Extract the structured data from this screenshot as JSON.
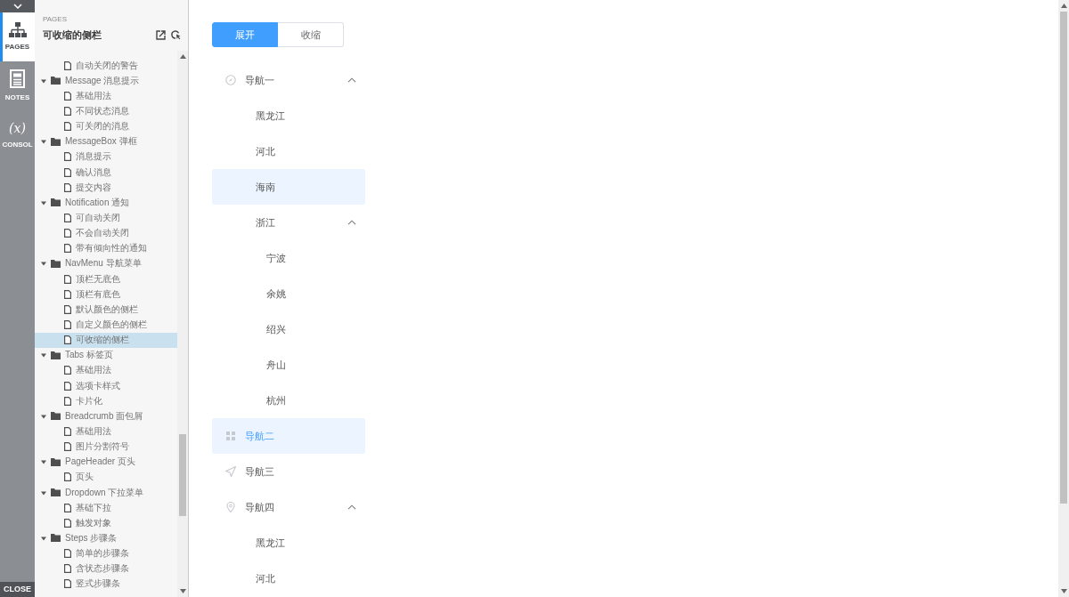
{
  "rail": {
    "tabs": [
      {
        "label": "PAGES",
        "selected": true
      },
      {
        "label": "NOTES",
        "selected": false
      },
      {
        "label": "CONSOL",
        "glyph": "(x)",
        "selected": false
      }
    ],
    "close": "CLOSE"
  },
  "sidebar": {
    "section": "PAGES",
    "title": "可收缩的侧栏",
    "tree": [
      {
        "children": [
          {
            "kind": "page",
            "label": "自动关闭的警告",
            "selected": false
          }
        ]
      },
      {
        "kind": "folder",
        "label": "Message 消息提示",
        "expanded": true,
        "children": [
          {
            "kind": "page",
            "label": "基础用法",
            "selected": false
          },
          {
            "kind": "page",
            "label": "不同状态消息",
            "selected": false
          },
          {
            "kind": "page",
            "label": "可关闭的消息",
            "selected": false
          }
        ]
      },
      {
        "kind": "folder",
        "label": "MessageBox 弹框",
        "expanded": true,
        "children": [
          {
            "kind": "page",
            "label": "消息提示",
            "selected": false
          },
          {
            "kind": "page",
            "label": "确认消息",
            "selected": false
          },
          {
            "kind": "page",
            "label": "提交内容",
            "selected": false
          }
        ]
      },
      {
        "kind": "folder",
        "label": "Notification 通知",
        "expanded": true,
        "children": [
          {
            "kind": "page",
            "label": "可自动关闭",
            "selected": false
          },
          {
            "kind": "page",
            "label": "不会自动关闭",
            "selected": false
          },
          {
            "kind": "page",
            "label": "带有倾向性的通知",
            "selected": false
          }
        ]
      },
      {
        "kind": "folder",
        "label": "NavMenu 导航菜单",
        "expanded": true,
        "children": [
          {
            "kind": "page",
            "label": "顶栏无底色",
            "selected": false
          },
          {
            "kind": "page",
            "label": "顶栏有底色",
            "selected": false
          },
          {
            "kind": "page",
            "label": "默认颜色的侧栏",
            "selected": false
          },
          {
            "kind": "page",
            "label": "自定义颜色的侧栏",
            "selected": false
          },
          {
            "kind": "page",
            "label": "可收缩的侧栏",
            "selected": true
          }
        ]
      },
      {
        "kind": "folder",
        "label": "Tabs 标签页",
        "expanded": true,
        "children": [
          {
            "kind": "page",
            "label": "基础用法",
            "selected": false
          },
          {
            "kind": "page",
            "label": "选项卡样式",
            "selected": false
          },
          {
            "kind": "page",
            "label": "卡片化",
            "selected": false
          }
        ]
      },
      {
        "kind": "folder",
        "label": "Breadcrumb 面包屑",
        "expanded": true,
        "children": [
          {
            "kind": "page",
            "label": "基础用法",
            "selected": false
          },
          {
            "kind": "page",
            "label": "图片分割符号",
            "selected": false
          }
        ]
      },
      {
        "kind": "folder",
        "label": "PageHeader 页头",
        "expanded": true,
        "children": [
          {
            "kind": "page",
            "label": "页头",
            "selected": false
          }
        ]
      },
      {
        "kind": "folder",
        "label": "Dropdown 下拉菜单",
        "expanded": true,
        "children": [
          {
            "kind": "page",
            "label": "基础下拉",
            "selected": false
          },
          {
            "kind": "page",
            "label": "触发对象",
            "selected": false
          }
        ]
      },
      {
        "kind": "folder",
        "label": "Steps 步骤条",
        "expanded": true,
        "children": [
          {
            "kind": "page",
            "label": "简单的步骤条",
            "selected": false
          },
          {
            "kind": "page",
            "label": "含状态步骤条",
            "selected": false
          },
          {
            "kind": "page",
            "label": "竖式步骤条",
            "selected": false
          }
        ]
      }
    ]
  },
  "preview": {
    "toggle": [
      {
        "label": "展开",
        "selected": true
      },
      {
        "label": "收缩",
        "selected": false
      }
    ],
    "menu": [
      {
        "label": "导航一",
        "selected": false,
        "hovered": false,
        "expanded": true,
        "children": [
          {
            "label": "黑龙江",
            "selected": false,
            "hovered": false
          },
          {
            "label": "河北",
            "selected": false,
            "hovered": false
          },
          {
            "label": "海南",
            "selected": false,
            "hovered": true
          },
          {
            "label": "浙江",
            "selected": false,
            "hovered": false,
            "expanded": true,
            "children": [
              {
                "label": "宁波",
                "selected": false,
                "hovered": false
              },
              {
                "label": "余姚",
                "selected": false,
                "hovered": false
              },
              {
                "label": "绍兴",
                "selected": false,
                "hovered": false
              },
              {
                "label": "舟山",
                "selected": false,
                "hovered": false
              },
              {
                "label": "杭州",
                "selected": false,
                "hovered": false
              }
            ]
          }
        ]
      },
      {
        "label": "导航二",
        "selected": true,
        "hovered": true
      },
      {
        "label": "导航三",
        "selected": false,
        "hovered": false
      },
      {
        "label": "导航四",
        "selected": false,
        "hovered": false,
        "expanded": true,
        "children": [
          {
            "label": "黑龙江",
            "selected": false,
            "hovered": false
          },
          {
            "label": "河北",
            "selected": false,
            "hovered": false
          }
        ]
      }
    ]
  }
}
